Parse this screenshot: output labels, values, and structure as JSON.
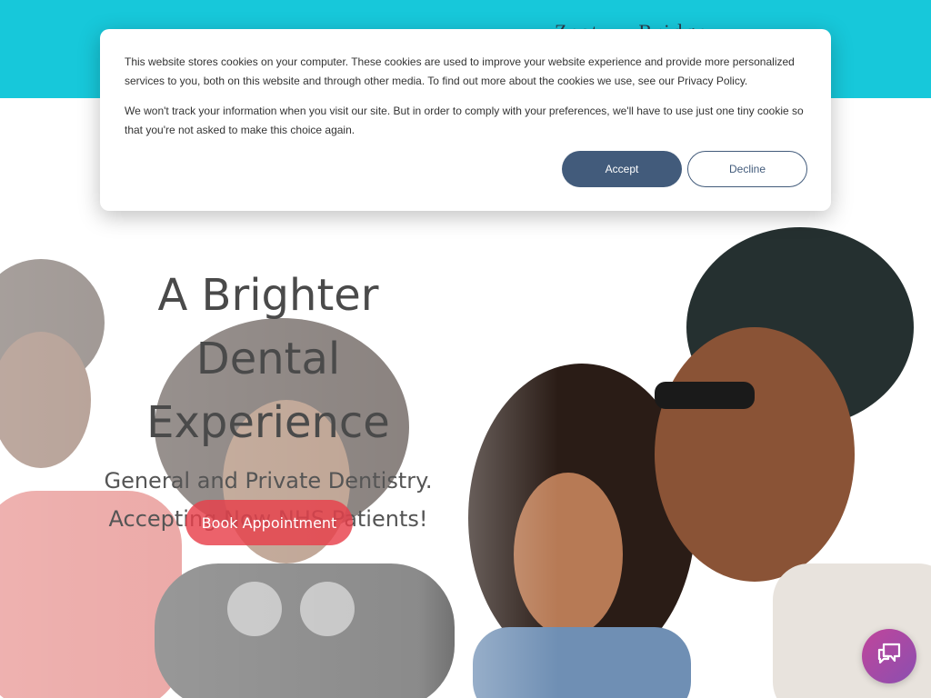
{
  "header": {
    "partial_text": "Zest    ...   Bridge"
  },
  "cookie_banner": {
    "paragraph1": "This website stores cookies on your computer. These cookies are used to improve your website experience and provide more personalized services to you, both on this website and through other media. To find out more about the cookies we use, see our Privacy Policy.",
    "paragraph2": "We won't track your information when you visit our site. But in order to comply with your preferences, we'll have to use just one tiny cookie so that you're not asked to make this choice again.",
    "accept_label": "Accept",
    "decline_label": "Decline"
  },
  "hero": {
    "headline": "A Brighter Dental Experience",
    "subline": "General and Private Dentistry. Accepting Now NHS Patients!",
    "cta_label": "Book Appointment"
  },
  "chat": {
    "icon": "chat-bubbles-icon"
  },
  "colors": {
    "topbar": "#17c8da",
    "accept": "#425b7b",
    "cta": "#e8404a",
    "chat": "#b0489f"
  }
}
